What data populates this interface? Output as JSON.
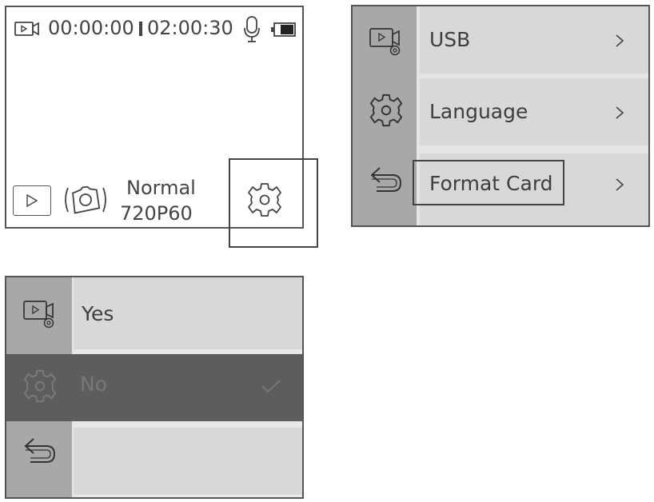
{
  "preview_screen": {
    "elapsed_time": "00:00:00",
    "remaining_time": "02:00:30",
    "mode": "Normal",
    "resolution": "720P60",
    "icons": {
      "video_mode": "video-camera-icon",
      "remaining_marker": "card-bar-icon",
      "microphone": "microphone-icon",
      "battery": "battery-icon",
      "playback": "play-icon",
      "photo": "camera-flip-icon",
      "settings": "gear-icon"
    }
  },
  "settings_menu": {
    "sidebar_icons": [
      "video-settings-icon",
      "gear-icon",
      "back-arrow-icon"
    ],
    "items": [
      {
        "label": "USB",
        "chevron": ">"
      },
      {
        "label": "Language",
        "chevron": ">"
      },
      {
        "label": "Format Card",
        "chevron": ">"
      }
    ]
  },
  "format_confirm": {
    "sidebar_icons": [
      "video-settings-icon",
      "gear-icon",
      "back-arrow-icon"
    ],
    "options": [
      {
        "label": "Yes",
        "selected": false
      },
      {
        "label": "No",
        "selected": true
      },
      {
        "label": "",
        "selected": false
      }
    ]
  },
  "colors": {
    "frame": "#555555",
    "sidebar": "#a8a8a8",
    "row": "#d8d8d8",
    "selected_row": "#5d5d5d"
  }
}
